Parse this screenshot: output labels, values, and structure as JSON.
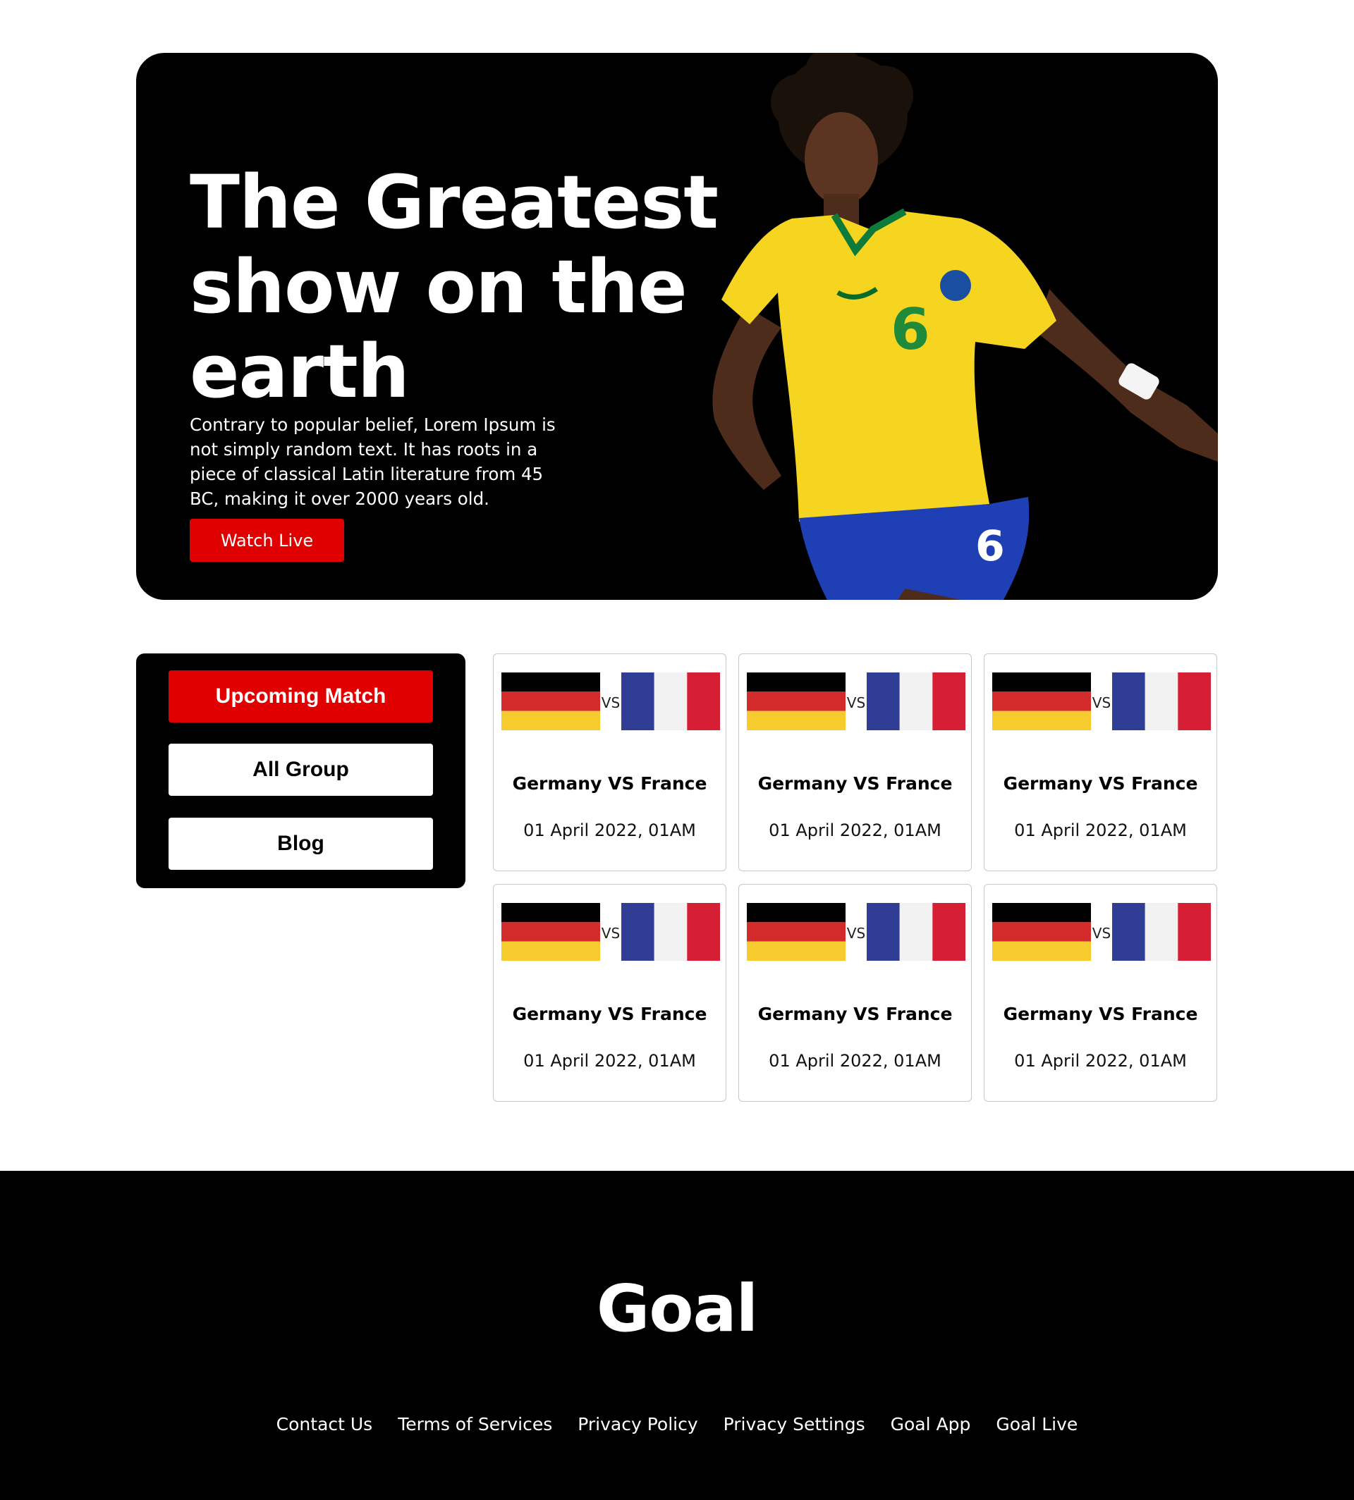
{
  "hero": {
    "title": "The Greatest show on the earth",
    "description": "Contrary to popular belief, Lorem Ipsum is not simply random text. It has roots in a piece of classical Latin literature from 45 BC, making it over 2000 years old.",
    "cta_label": "Watch Live",
    "accent": "#e00000"
  },
  "sidebar": {
    "items": [
      {
        "label": "Upcoming Match",
        "active": true
      },
      {
        "label": "All Group",
        "active": false
      },
      {
        "label": "Blog",
        "active": false
      }
    ]
  },
  "matches": [
    {
      "team_a_flag": "germany-flag-icon",
      "team_b_flag": "france-flag-icon",
      "vs": "VS",
      "title": "Germany VS France",
      "date": "01 April 2022, 01AM"
    },
    {
      "team_a_flag": "germany-flag-icon",
      "team_b_flag": "france-flag-icon",
      "vs": "VS",
      "title": "Germany VS France",
      "date": "01 April 2022, 01AM"
    },
    {
      "team_a_flag": "germany-flag-icon",
      "team_b_flag": "france-flag-icon",
      "vs": "VS",
      "title": "Germany VS France",
      "date": "01 April 2022, 01AM"
    },
    {
      "team_a_flag": "germany-flag-icon",
      "team_b_flag": "france-flag-icon",
      "vs": "VS",
      "title": "Germany VS France",
      "date": "01 April 2022, 01AM"
    },
    {
      "team_a_flag": "germany-flag-icon",
      "team_b_flag": "france-flag-icon",
      "vs": "VS",
      "title": "Germany VS France",
      "date": "01 April 2022, 01AM"
    },
    {
      "team_a_flag": "germany-flag-icon",
      "team_b_flag": "france-flag-icon",
      "vs": "VS",
      "title": "Germany VS France",
      "date": "01 April 2022, 01AM"
    }
  ],
  "footer": {
    "logo": "Goal",
    "links": [
      "Contact Us",
      "Terms of Services",
      "Privacy Policy",
      "Privacy Settings",
      "Goal App",
      "Goal Live"
    ]
  }
}
